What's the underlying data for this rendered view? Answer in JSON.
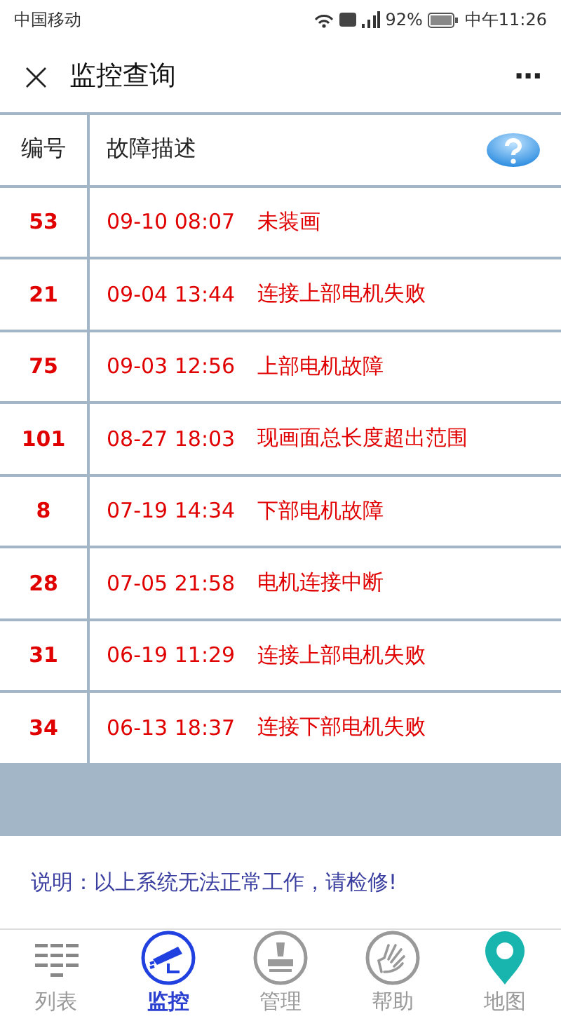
{
  "status_bar": {
    "carrier": "中国移动",
    "battery": "92%",
    "time": "中午11:26"
  },
  "header": {
    "close": "×",
    "title": "监控查询",
    "more": "···"
  },
  "table": {
    "columns": [
      "编号",
      "故障描述"
    ],
    "rows": [
      {
        "id": "53",
        "time": "09-10 08:07",
        "fault": "未装画"
      },
      {
        "id": "21",
        "time": "09-04 13:44",
        "fault": "连接上部电机失败"
      },
      {
        "id": "75",
        "time": "09-03 12:56",
        "fault": "上部电机故障"
      },
      {
        "id": "101",
        "time": "08-27 18:03",
        "fault": "现画面总长度超出范围"
      },
      {
        "id": "8",
        "time": "07-19 14:34",
        "fault": "下部电机故障"
      },
      {
        "id": "28",
        "time": "07-05 21:58",
        "fault": "电机连接中断"
      },
      {
        "id": "31",
        "time": "06-19 11:29",
        "fault": "连接上部电机失败"
      },
      {
        "id": "34",
        "time": "06-13 18:37",
        "fault": "连接下部电机失败"
      }
    ]
  },
  "note": "说明：以上系统无法正常工作，请检修!",
  "tabs": [
    {
      "kind": "list",
      "label": "列表",
      "selected": false
    },
    {
      "kind": "camera",
      "label": "监控",
      "selected": true
    },
    {
      "kind": "stamp",
      "label": "管理",
      "selected": false
    },
    {
      "kind": "hand",
      "label": "帮助",
      "selected": false
    },
    {
      "kind": "pin",
      "label": "地图",
      "selected": false
    }
  ]
}
